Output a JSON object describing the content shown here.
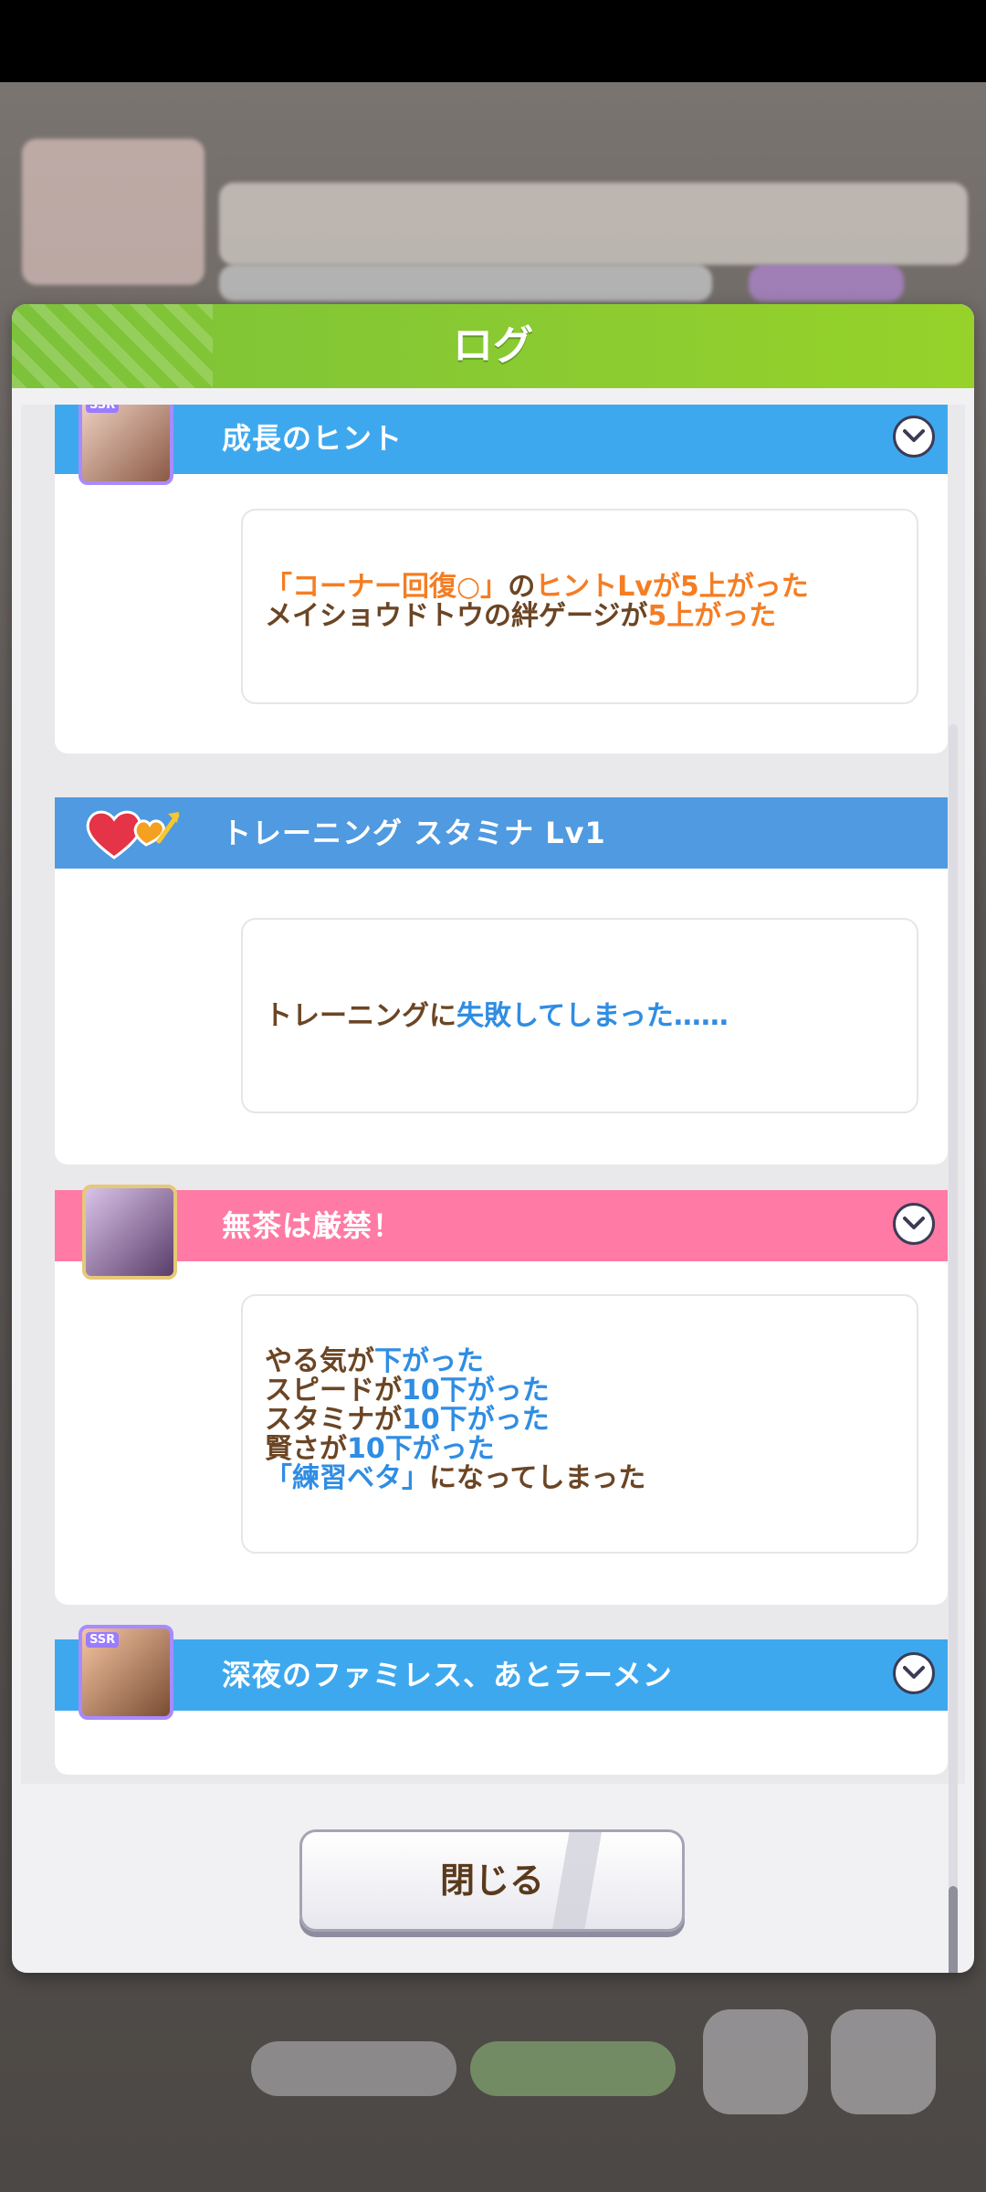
{
  "modal": {
    "title": "ログ",
    "close_label": "閉じる"
  },
  "entries": [
    {
      "title": "成長のヒント",
      "rows": [
        [
          {
            "t": "「コーナー回復○」",
            "c": "orange"
          },
          {
            "t": "の",
            "c": "brown"
          },
          {
            "t": "ヒントLvが5上がった",
            "c": "orange"
          }
        ],
        [
          {
            "t": "メイショウドトウの絆ゲージが",
            "c": "brown"
          },
          {
            "t": "5上がった",
            "c": "orange"
          }
        ]
      ]
    },
    {
      "title": "トレーニング スタミナ Lv1",
      "rows": [
        [
          {
            "t": "トレーニングに",
            "c": "brown"
          },
          {
            "t": "失敗してしまった……",
            "c": "blue"
          }
        ]
      ]
    },
    {
      "title": "無茶は厳禁！",
      "rows": [
        [
          {
            "t": "やる気が",
            "c": "brown"
          },
          {
            "t": "下がった",
            "c": "blue"
          }
        ],
        [
          {
            "t": "スピードが",
            "c": "brown"
          },
          {
            "t": "10下がった",
            "c": "blue"
          }
        ],
        [
          {
            "t": "スタミナが",
            "c": "brown"
          },
          {
            "t": "10下がった",
            "c": "blue"
          }
        ],
        [
          {
            "t": "賢さが",
            "c": "brown"
          },
          {
            "t": "10下がった",
            "c": "blue"
          }
        ],
        [
          {
            "t": "「練習ベタ」",
            "c": "blue"
          },
          {
            "t": "になってしまった",
            "c": "brown"
          }
        ]
      ]
    },
    {
      "title": "深夜のファミレス、あとラーメン"
    }
  ],
  "ssr_tag": "SSR",
  "icons": [
    "chevron-down-icon",
    "heart-arrow-icon"
  ],
  "colors": {
    "header_green": "#7cc23a",
    "blue": "#3ea8ef",
    "pink": "#ff7aa4",
    "highlight_orange": "#f57d22",
    "highlight_blue": "#2f8de3",
    "text_brown": "#6b4524"
  }
}
